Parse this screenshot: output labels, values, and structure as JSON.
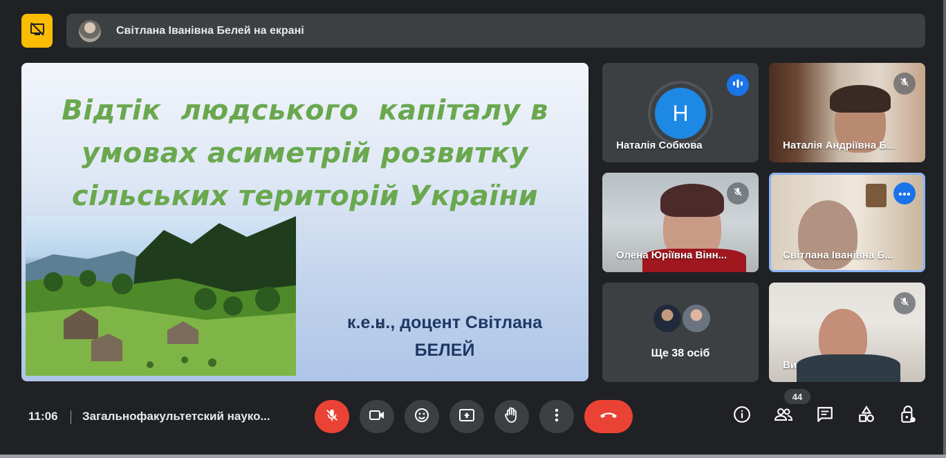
{
  "presenting": {
    "text": "Світлана Іванівна Белей на екрані"
  },
  "slide": {
    "title_line1": "Відтік  людського  капіталу в",
    "title_line2": "умовах асиметрій розвитку",
    "title_line3": "сільських територій України",
    "author_line1": "к.е.н., доцент Світлана",
    "author_line2": "БЕЛЕЙ"
  },
  "participants": [
    {
      "name": "Наталія Собкова",
      "initial": "Н",
      "state": "speaking"
    },
    {
      "name": "Наталія Андріївна Б...",
      "state": "muted"
    },
    {
      "name": "Олена Юріївна Вінн...",
      "state": "muted"
    },
    {
      "name": "Світлана Іванівна Б...",
      "state": "selected"
    },
    {
      "name": "Ще 38 осіб",
      "state": "overflow"
    },
    {
      "name": "Ви",
      "state": "muted"
    }
  ],
  "bottom_bar": {
    "time": "11:06",
    "meeting_title": "Загальнофакультетский науко...",
    "participant_count": "44"
  },
  "icons": {
    "present": "present-stop-icon",
    "mic": "mic-off-icon",
    "camera": "camera-icon",
    "emoji": "emoji-icon",
    "share": "present-screen-icon",
    "hand": "raise-hand-icon",
    "more": "more-vert-icon",
    "hangup": "call-end-icon",
    "info": "info-icon",
    "people": "people-icon",
    "chat": "chat-icon",
    "activities": "activities-icon",
    "lock": "host-controls-icon"
  },
  "colors": {
    "background": "#202124",
    "present_accent": "#fbbc04",
    "danger": "#ea4335",
    "blue": "#1a73e8",
    "slide_title": "#6aa84f",
    "slide_author": "#1f3864"
  }
}
